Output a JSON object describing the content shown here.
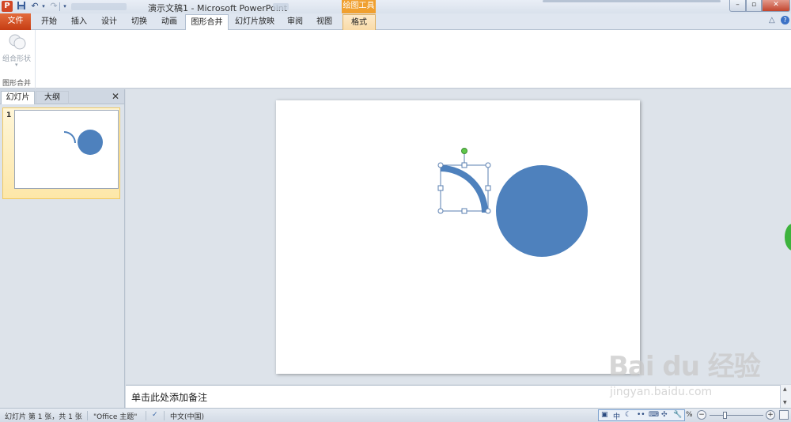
{
  "window": {
    "title": "演示文稿1 - Microsoft PowerPoint",
    "app_icon": "P",
    "contextual_group": "绘图工具",
    "minimize_glyph": "–",
    "maximize_glyph": "▫",
    "close_glyph": "✕"
  },
  "quick_access": {
    "save_icon": "floppy-disk",
    "undo_icon": "undo-arrow",
    "redo_icon": "redo-arrow",
    "customize_icon": "dropdown-arrow"
  },
  "ribbon_tabs": [
    {
      "label": "文件"
    },
    {
      "label": "开始"
    },
    {
      "label": "插入"
    },
    {
      "label": "设计"
    },
    {
      "label": "切换"
    },
    {
      "label": "动画"
    },
    {
      "label": "图形合并"
    },
    {
      "label": "幻灯片放映"
    },
    {
      "label": "审阅"
    },
    {
      "label": "视图"
    },
    {
      "label": "格式"
    }
  ],
  "active_tab": "图形合并",
  "ribbon_right": {
    "minimize_glyph": "△",
    "help_glyph": "?"
  },
  "ribbon": {
    "combine_button_label": "组合形状",
    "combine_button_arrow": "▾",
    "group_label": "图形合并"
  },
  "left_pane": {
    "tabs": [
      "幻灯片",
      "大纲"
    ],
    "close_glyph": "✕",
    "slides": [
      {
        "number": "1"
      }
    ]
  },
  "slide": {
    "shapes": [
      {
        "type": "quarter-arc",
        "color": "#4e81bd",
        "selected": true
      },
      {
        "type": "circle",
        "color": "#4e81bd",
        "selected": false
      }
    ]
  },
  "notes": {
    "placeholder": "单击此处添加备注"
  },
  "watermark": {
    "brand": "Bai du 经验",
    "url": "jingyan.baidu.com"
  },
  "status_bar": {
    "slide_info": "幻灯片 第 1 张，共 1 张",
    "theme": "\"Office 主题\"",
    "language": "中文(中国)",
    "zoom_suffix": "%",
    "ime": {
      "mode": "中",
      "icons": [
        "moon-icon",
        "dots-icon",
        "keyboard-icon",
        "punctuation-icon",
        "wrench-icon"
      ]
    },
    "zoom_minus": "−",
    "zoom_plus": "+"
  },
  "colors": {
    "shape_fill": "#4e81bd",
    "file_tab": "#d04a1c",
    "contextual_tab": "#f0a030",
    "selection_handle": "#5a7fb0",
    "rotation_handle": "#5fc84a"
  }
}
